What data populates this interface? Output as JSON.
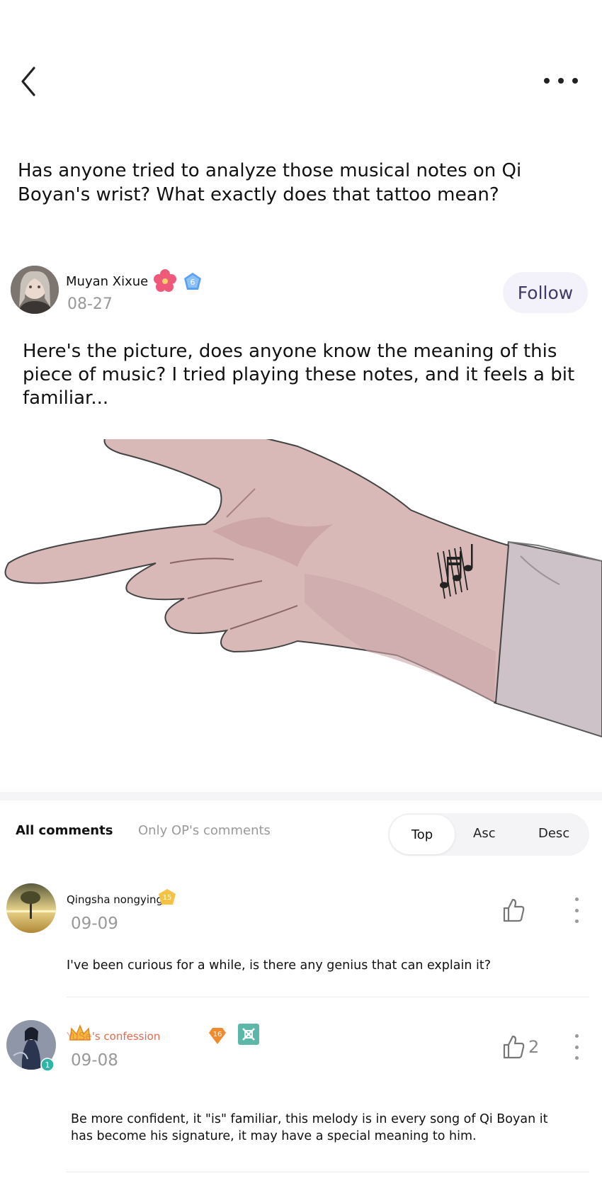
{
  "post": {
    "title": "Has anyone tried to analyze those musical notes on Qi Boyan's wrist? What exactly does that tattoo mean?",
    "author": {
      "name": "Muyan Xixue",
      "level": "6",
      "date": "08-27",
      "follow_label": "Follow"
    },
    "body": "Here's the picture, does anyone know the meaning of this piece of music? I tried playing these notes, and it feels a bit familiar..."
  },
  "comment_tabs": {
    "all": "All comments",
    "op_only": "Only OP's comments"
  },
  "sort": {
    "top": "Top",
    "asc": "Asc",
    "desc": "Desc",
    "selected": "Top"
  },
  "comments": [
    {
      "name": "Qingsha nongying",
      "level": "15",
      "date": "09-09",
      "likes": "",
      "text": "I've been curious for a while, is there any genius that can explain it?"
    },
    {
      "name": "'s confession",
      "name_prefix": "YuSe",
      "level": "16",
      "avatar_badge": "1",
      "date": "09-08",
      "likes": "2",
      "text": "Be more confident, it \"is\" familiar, this melody is in every song of Qi Boyan it has become his signature, it may have a special meaning to him."
    }
  ],
  "colors": {
    "follow_bg": "#f3f1f9",
    "follow_text": "#3f3a66",
    "muted": "#999999",
    "orange_badge": "#f08a2c",
    "gold_badge": "#f5c242",
    "blue_badge": "#5aa0f0",
    "teal_badge": "#5bb8a8",
    "confession_name": "#e46a4a"
  }
}
